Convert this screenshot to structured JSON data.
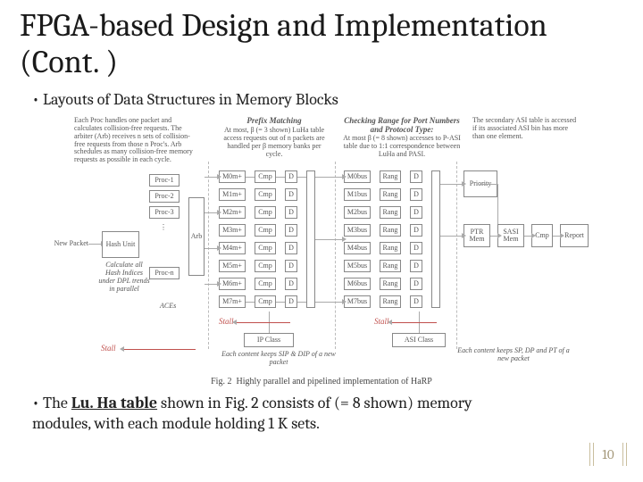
{
  "title": "FPGA-based Design and Implementation (Cont. )",
  "bullets": {
    "b1": "Layouts of Data Structures in Memory Blocks",
    "b2_a": "The ",
    "b2_emph": "Lu. Ha table",
    "b2_b": " shown in Fig. 2 consists of (= 8 shown) memory modules, with each module holding 1 K sets."
  },
  "page_number": "10",
  "figure": {
    "caption_prefix": "Fig. 2",
    "caption_text": "Highly parallel and pipelined implementation of HaRP",
    "headers": {
      "left_desc": "Each Proc handles one packet and calculates collision-free requests. The arbiter (Arb) receives n sets of collision-free requests from those n Proc's. Arb schedules as many collision-free memory requests as possible in each cycle.",
      "mid_title": "Prefix Matching",
      "mid_desc": "At most, β (= 3 shown) LuHa table access requests out of n packets are handled per β memory banks per cycle.",
      "right_title": "Checking Range for Port Numbers and Protocol Type:",
      "right_desc": "At most β (= 8 shown) accesses to P-ASI table due to 1:1 correspondence between LuHa and PASI.",
      "far_desc": "The secondary ASI table is accessed if its associated ASI bin has more than one element."
    },
    "left": {
      "new_packet": "New Packet",
      "hash_unit": "Hash Unit",
      "proc": [
        "Proc-1",
        "Proc-2",
        "Proc-3",
        "Proc-n"
      ],
      "arb": "Arb",
      "note": "Calculate all Hash Indices under DPL trends in parallel",
      "aces": "ACEs"
    },
    "mid": {
      "M": [
        "M0m+",
        "M1m+",
        "M2m+",
        "M3m+",
        "M4m+",
        "M5m+",
        "M6m+",
        "M7m+"
      ],
      "cmp": "Cmp",
      "D": "D",
      "Mbus": [
        "M0bus",
        "M1bus",
        "M2bus",
        "M3bus",
        "M4bus",
        "M5bus",
        "M6bus",
        "M7bus"
      ],
      "rang": "Rang",
      "ip_class": "IP Class",
      "note": "Each content keeps SIP & DIP of a new packet"
    },
    "right": {
      "priority": "Priority",
      "ptr_mem": "PTR Mem",
      "sasi_mem": "SASI Mem",
      "cmp": "Cmp",
      "report": "Report",
      "asi_class": "ASI Class",
      "note": "Each content keeps SP, DP and PT of a new packet"
    },
    "stall": "Stall"
  }
}
